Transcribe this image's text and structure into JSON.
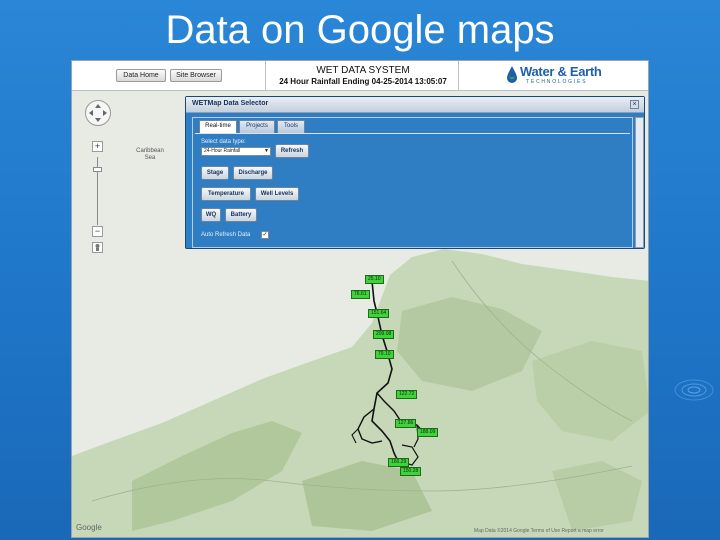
{
  "slide": {
    "title": "Data on Google maps"
  },
  "header": {
    "buttons": [
      {
        "label": "Data Home"
      },
      {
        "label": "Site Browser"
      }
    ],
    "system_title": "WET DATA SYSTEM",
    "subtitle": "24 Hour Rainfall Ending 04-25-2014 13:05:07",
    "logo_text": "Water & Earth",
    "logo_tagline": "TECHNOLOGIES"
  },
  "map": {
    "label_line1": "Caribbean",
    "label_line2": "Sea",
    "logo": "Google",
    "credit": "Map Data ©2014 Google  Terms of Use  Report a map error"
  },
  "dialog": {
    "title": "WETMap Data Selector",
    "close": "×",
    "tabs": [
      {
        "label": "Real-time"
      },
      {
        "label": "Projects"
      },
      {
        "label": "Tools"
      }
    ],
    "select_label": "Select data type:",
    "select_value": "24-Hour Rainfall",
    "refresh_label": "Refresh",
    "buttons": [
      {
        "label": "Stage"
      },
      {
        "label": "Discharge"
      },
      {
        "label": "Temperature"
      },
      {
        "label": "Well Levels"
      },
      {
        "label": "WQ"
      },
      {
        "label": "Battery"
      }
    ],
    "auto_refresh_label": "Auto Refresh Data",
    "auto_refresh_check": "✓"
  },
  "markers": [
    {
      "value": "25.10"
    },
    {
      "value": "76.61"
    },
    {
      "value": "151.64"
    },
    {
      "value": "209.08"
    },
    {
      "value": "79.10"
    },
    {
      "value": "122.72"
    },
    {
      "value": "127.86"
    },
    {
      "value": "188.09"
    },
    {
      "value": "166.29"
    },
    {
      "value": "150.28"
    }
  ],
  "colors": {
    "marker_fill": "#3fd23a",
    "dialog_blue": "#2f7dc3",
    "slide_blue": "#2a86d6"
  }
}
